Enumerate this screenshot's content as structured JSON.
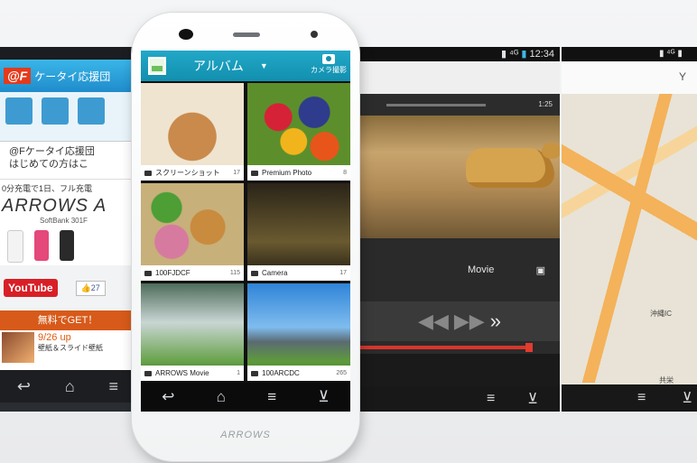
{
  "left_screen": {
    "logo": "@F",
    "header_title": "ケータイ応援団",
    "notice_line1": "@Fケータイ応援団",
    "notice_line2": "はじめての方はこ",
    "ad_line": "0分充電で1日、フル充電",
    "brand": "ARROWS A",
    "model": "SoftBank 301F",
    "youtube": "YouTube",
    "like_count": "27",
    "free_banner": "無料でGET！",
    "news_date": "9/26 up",
    "news_text": "壁紙＆スライド壁紙",
    "nav": [
      "↩",
      "⌂",
      "≡"
    ]
  },
  "center_phone": {
    "app_title": "アルバム",
    "dropdown_icon": "▼",
    "camera_label": "カメラ撮影",
    "albums": [
      {
        "name": "スクリーンショット",
        "count": "17"
      },
      {
        "name": "Premium Photo",
        "count": "8"
      },
      {
        "name": "100FJDCF",
        "count": "115"
      },
      {
        "name": "Camera",
        "count": "17"
      },
      {
        "name": "ARROWS Movie",
        "count": "1"
      },
      {
        "name": "100ARCDC",
        "count": "265"
      }
    ],
    "nav": [
      "↩",
      "⌂",
      "≡",
      "⊻"
    ],
    "brand": "ARROWS"
  },
  "video_screen": {
    "status_time": "12:34",
    "elapsed": "1:25",
    "title": "Movie",
    "controls": "»",
    "seek_progress": 0.96,
    "nav": [
      "≡",
      "⊻"
    ]
  },
  "map_screen": {
    "label_station": "沖縄IC",
    "label_road": "共栄",
    "nav": [
      "≡",
      "⊻"
    ]
  }
}
